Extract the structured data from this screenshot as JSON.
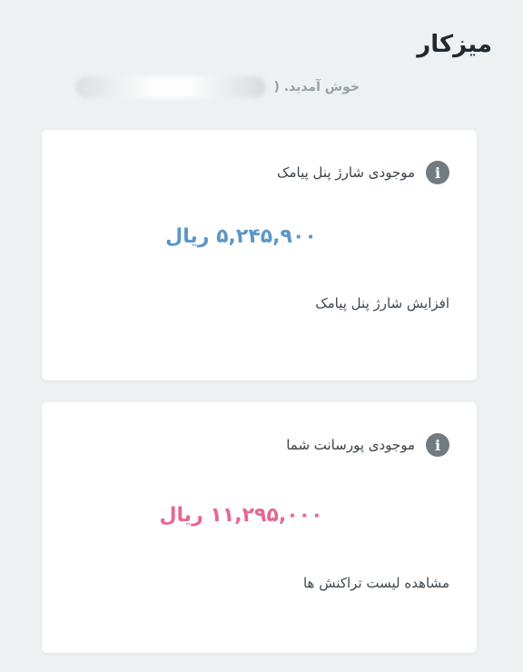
{
  "header": {
    "title": "میزکار",
    "welcome": "خوش آمدید. ("
  },
  "cards": [
    {
      "title": "موجودی شارژ پنل پیامک",
      "amount": "۵,۲۴۵,۹۰۰ ریال",
      "link": "افزایش شارژ پنل پیامک",
      "amount_color": "#5b97c7"
    },
    {
      "title": "موجودی پورسانت شما",
      "amount": "۱۱,۲۹۵,۰۰۰ ریال",
      "link": "مشاهده لیست تراکنش ها",
      "amount_color": "#e56891"
    }
  ],
  "icons": {
    "info": "info-icon",
    "info_glyph": "i"
  }
}
